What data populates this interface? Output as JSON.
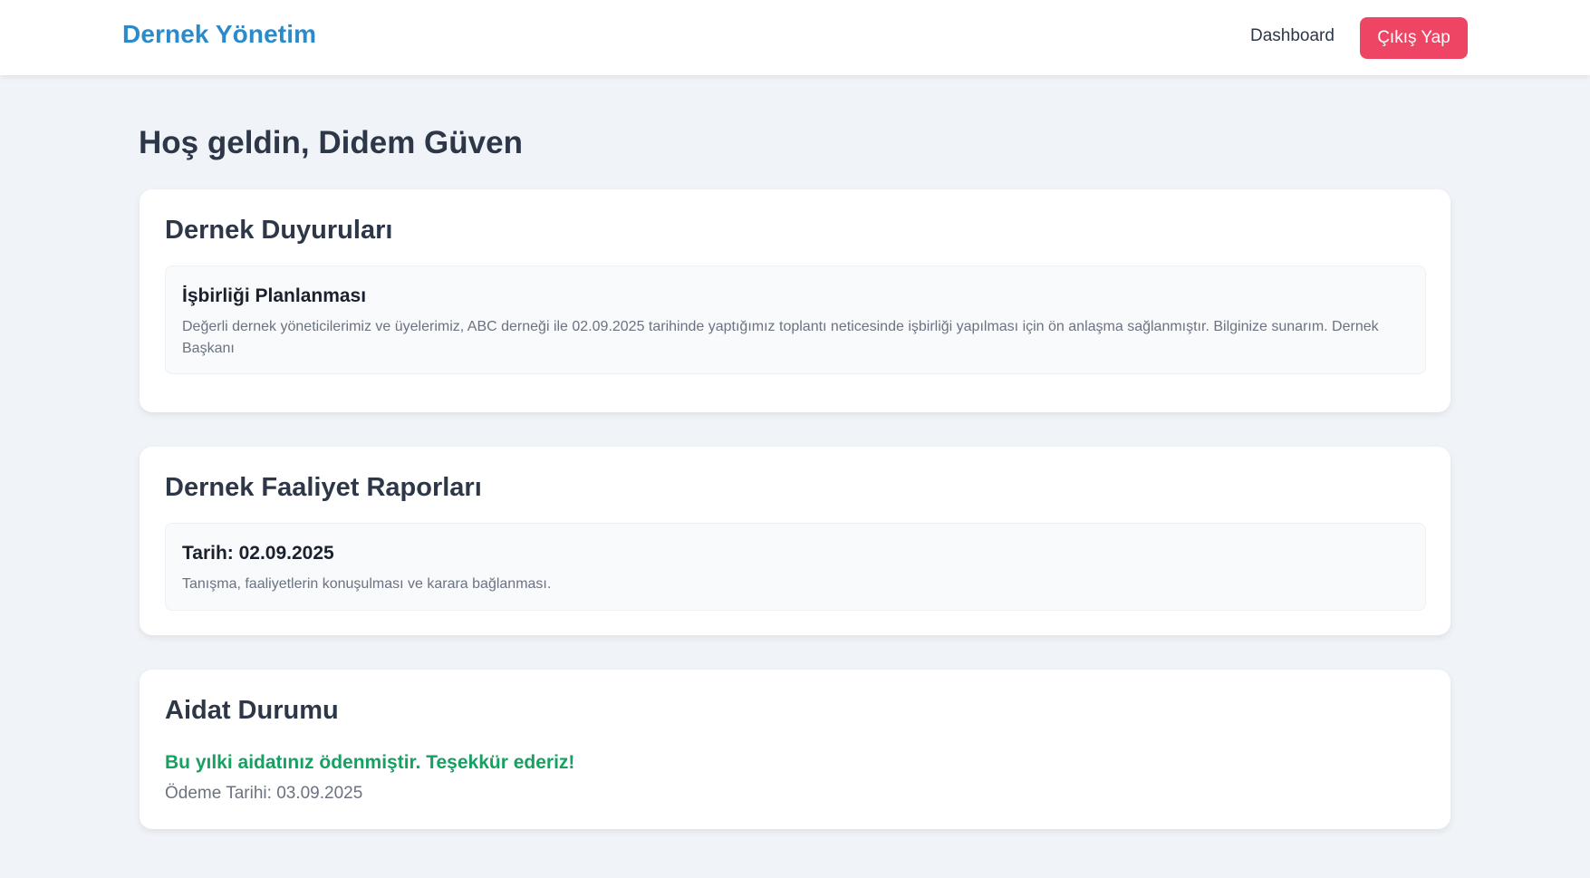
{
  "nav": {
    "brand": "Dernek Yönetim",
    "dashboard_link": "Dashboard",
    "logout_button": "Çıkış Yap"
  },
  "welcome": "Hoş geldin, Didem Güven",
  "announcements": {
    "heading": "Dernek Duyuruları",
    "items": [
      {
        "title": "İşbirliği Planlanması",
        "body": "Değerli dernek yöneticilerimiz ve üyelerimiz, ABC derneği ile 02.09.2025 tarihinde yaptığımız toplantı neticesinde işbirliği yapılması için ön anlaşma sağlanmıştır. Bilginize sunarım. Dernek Başkanı"
      }
    ]
  },
  "reports": {
    "heading": "Dernek Faaliyet Raporları",
    "items": [
      {
        "title": "Tarih: 02.09.2025",
        "body": "Tanışma, faaliyetlerin konuşulması ve karara bağlanması."
      }
    ]
  },
  "dues": {
    "heading": "Aidat Durumu",
    "status": "Bu yılki aidatınız ödenmiştir. Teşekkür ederiz!",
    "payment_date": "Ödeme Tarihi: 03.09.2025"
  },
  "colors": {
    "brand": "#2b8ac9",
    "logout": "#ef4565",
    "paid": "#16a061",
    "background": "#f0f4f8"
  }
}
